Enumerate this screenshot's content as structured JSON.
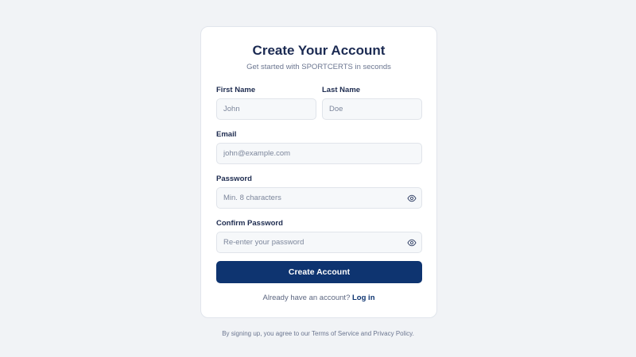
{
  "form": {
    "title": "Create Your Account",
    "subtitle": "Get started with SPORTCERTS in seconds",
    "first_name": {
      "label": "First Name",
      "placeholder": "John",
      "value": ""
    },
    "last_name": {
      "label": "Last Name",
      "placeholder": "Doe",
      "value": ""
    },
    "email": {
      "label": "Email",
      "placeholder": "john@example.com",
      "value": ""
    },
    "password": {
      "label": "Password",
      "placeholder": "Min. 8 characters",
      "value": "",
      "icon": "eye-icon"
    },
    "confirm_password": {
      "label": "Confirm Password",
      "placeholder": "Re-enter your password",
      "value": "",
      "icon": "eye-icon"
    },
    "submit_label": "Create Account",
    "login_prompt": "Already have an account?",
    "login_link": "Log in"
  },
  "footer": {
    "terms_text": "By signing up, you agree to our Terms of Service and Privacy Policy."
  },
  "colors": {
    "background": "#f1f3f6",
    "card": "#ffffff",
    "primary": "#0e3470",
    "text": "#1b2a52",
    "muted": "#6b7690"
  }
}
